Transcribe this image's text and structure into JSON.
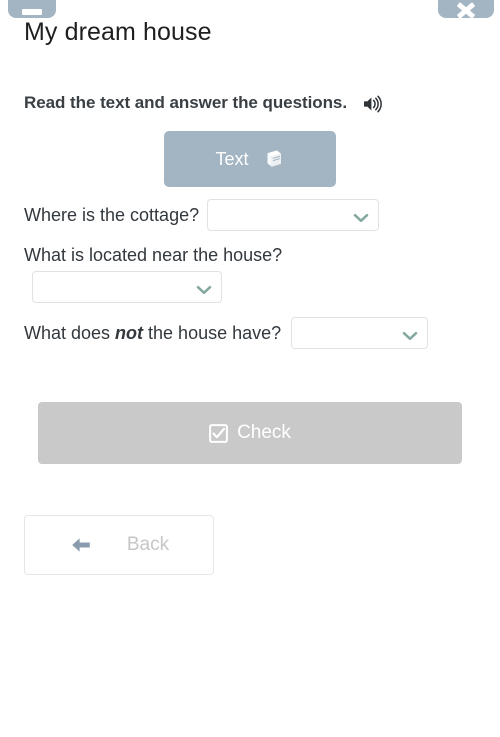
{
  "window": {
    "top_tabs": [
      {
        "name": "menu-tab",
        "icon": "menu-bar-icon",
        "label": ""
      },
      {
        "name": "close-tab",
        "icon": "close-icon",
        "label": ""
      }
    ]
  },
  "header": {
    "title": "My dream house"
  },
  "instruction": {
    "text": "Read the text and answer the questions.",
    "audio_icon": "speaker-icon"
  },
  "text_button": {
    "label": "Text",
    "icon": "book-icon",
    "color": "#a3b5c2"
  },
  "questions": [
    {
      "id": "q1",
      "label": "Where is the cottage?",
      "answer_value": "",
      "placeholder": "",
      "chevron_icon": "chevron-down-icon"
    },
    {
      "id": "q2",
      "label": "What is located near the house?",
      "answer_value": "",
      "placeholder": "",
      "chevron_icon": "chevron-down-icon"
    },
    {
      "id": "q3",
      "label_before": "What does ",
      "label_emphasis": "not",
      "label_after": " the house have?",
      "answer_value": "",
      "placeholder": "",
      "chevron_icon": "chevron-down-icon"
    }
  ],
  "actions": {
    "check_label": "Check",
    "check_icon": "checkbox-checked-icon",
    "check_enabled": false,
    "check_color": "#c9c9c9",
    "back_label": "Back",
    "back_icon": "arrow-left-icon"
  },
  "colors": {
    "accent": "#a3b5c2",
    "chevron": "#85a8a1",
    "title_text": "#1f1f1f",
    "body_text": "#32383d",
    "instruction_text": "#3a3f44",
    "disabled": "#c9c9c9",
    "back_arrow": "#8a9bad",
    "back_text": "#c6c6c6",
    "border": "#e2e2e2"
  }
}
